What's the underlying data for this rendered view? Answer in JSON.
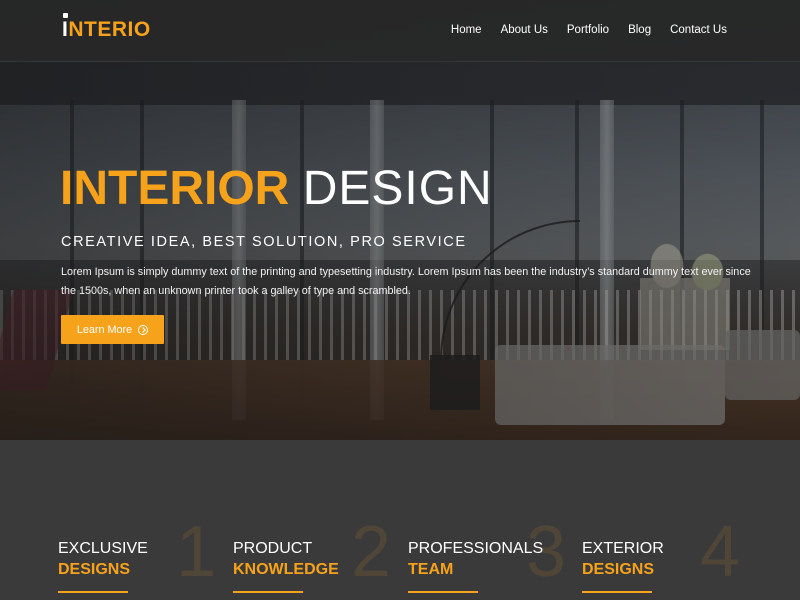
{
  "brand": {
    "logo_first": "I",
    "logo_rest": "NTERIO",
    "accent": "#f7a21b"
  },
  "nav": {
    "items": [
      "Home",
      "About Us",
      "Portfolio",
      "Blog",
      "Contact Us"
    ]
  },
  "hero": {
    "title_bold": "INTERIOR",
    "title_light": "DESIGN",
    "subtitle": "CREATIVE IDEA, BEST SOLUTION, PRO SERVICE",
    "description": "Lorem Ipsum is simply dummy text of the printing and typesetting industry. Lorem Ipsum has been the industry’s standard dummy text ever since the 1500s, when an unknown printer took a galley of type and scrambled.",
    "button_label": "Learn More"
  },
  "features": [
    {
      "line1": "EXCLUSIVE",
      "line2": "DESIGNS",
      "number": "1"
    },
    {
      "line1": "PRODUCT",
      "line2": "KNOWLEDGE",
      "number": "2"
    },
    {
      "line1": "PROFESSIONALS",
      "line2": "TEAM",
      "number": "3"
    },
    {
      "line1": "EXTERIOR",
      "line2": "DESIGNS",
      "number": "4"
    }
  ]
}
